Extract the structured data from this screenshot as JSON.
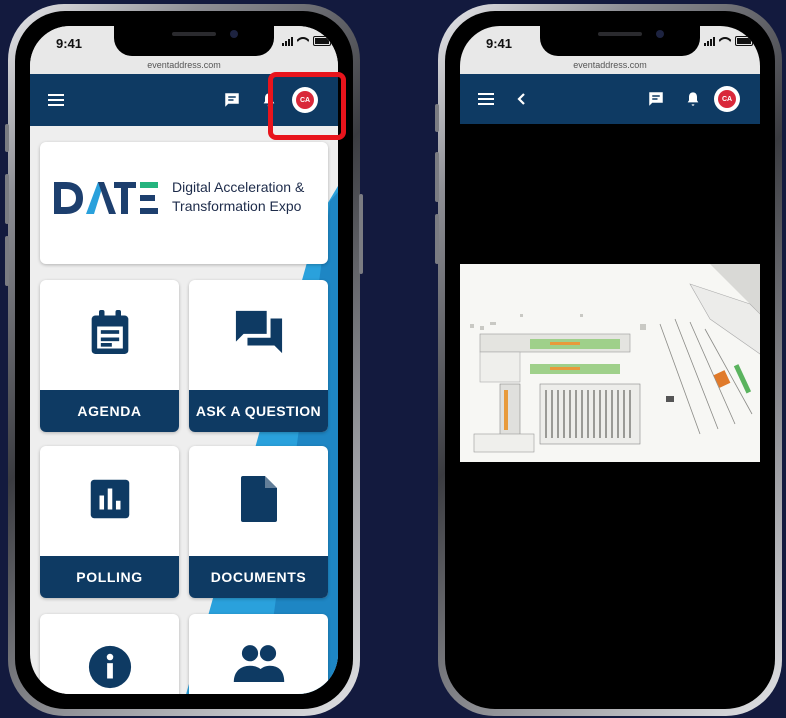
{
  "colors": {
    "background": "#131a3e",
    "appbar": "#0e3a63",
    "highlight": "#e8141c",
    "accent_stripe": "#2aa1dc",
    "avatar": "#d9283a"
  },
  "phone_left": {
    "status": {
      "time": "9:41"
    },
    "url": "eventaddress.com",
    "appbar": {
      "icons": [
        "hamburger-menu-icon",
        "chat-icon",
        "bell-icon"
      ],
      "avatar_initials": "CA"
    },
    "logo": {
      "wordmark": "DATE",
      "line1": "Digital Acceleration &",
      "line2": "Transformation Expo"
    },
    "tiles": [
      {
        "label": "AGENDA",
        "icon": "agenda-icon"
      },
      {
        "label": "ASK A QUESTION",
        "icon": "ask-question-icon"
      },
      {
        "label": "POLLING",
        "icon": "polling-icon"
      },
      {
        "label": "DOCUMENTS",
        "icon": "documents-icon"
      },
      {
        "label": "",
        "icon": "info-icon"
      },
      {
        "label": "",
        "icon": "people-icon"
      }
    ]
  },
  "phone_right": {
    "status": {
      "time": "9:41"
    },
    "url": "eventaddress.com",
    "appbar": {
      "icons": [
        "hamburger-menu-icon",
        "back-chevron-icon",
        "chat-icon",
        "bell-icon"
      ],
      "avatar_initials": "CA"
    },
    "content": {
      "image": "venue-floor-plan-map"
    }
  }
}
